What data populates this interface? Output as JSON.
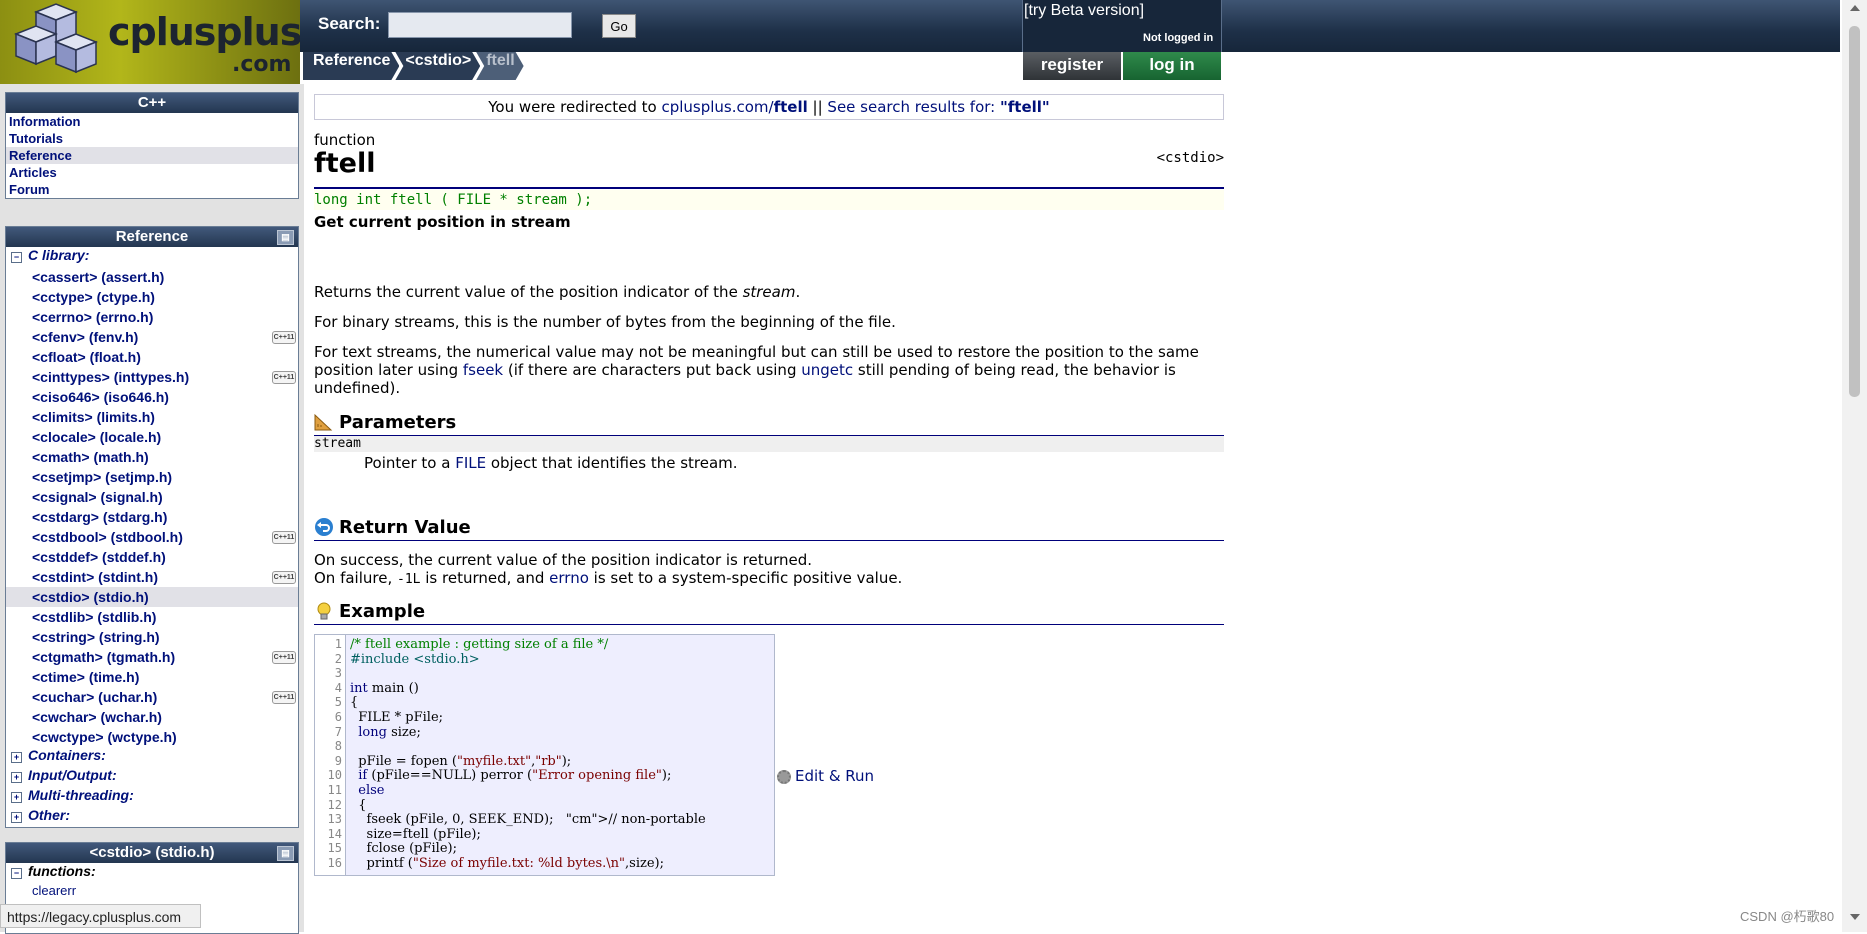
{
  "search": {
    "label": "Search:",
    "placeholder": "",
    "go_label": "Go"
  },
  "header": {
    "beta_link": "[try Beta version]",
    "login_status": "Not logged in"
  },
  "breadcrumb": [
    "Reference",
    "<cstdio>",
    "ftell"
  ],
  "auth": {
    "register": "register",
    "login": "log in"
  },
  "logo": {
    "word": "cplusplus",
    "domain": ".com"
  },
  "sidebar": {
    "cpp_box": {
      "title": "C++",
      "items": [
        "Information",
        "Tutorials",
        "Reference",
        "Articles",
        "Forum"
      ],
      "selected": "Reference"
    },
    "reference_box": {
      "title": "Reference",
      "c_library_label": "C library:",
      "c_library_items": [
        {
          "label": "<cassert> (assert.h)",
          "badge": ""
        },
        {
          "label": "<cctype> (ctype.h)",
          "badge": ""
        },
        {
          "label": "<cerrno> (errno.h)",
          "badge": ""
        },
        {
          "label": "<cfenv> (fenv.h)",
          "badge": "C++11"
        },
        {
          "label": "<cfloat> (float.h)",
          "badge": ""
        },
        {
          "label": "<cinttypes> (inttypes.h)",
          "badge": "C++11"
        },
        {
          "label": "<ciso646> (iso646.h)",
          "badge": ""
        },
        {
          "label": "<climits> (limits.h)",
          "badge": ""
        },
        {
          "label": "<clocale> (locale.h)",
          "badge": ""
        },
        {
          "label": "<cmath> (math.h)",
          "badge": ""
        },
        {
          "label": "<csetjmp> (setjmp.h)",
          "badge": ""
        },
        {
          "label": "<csignal> (signal.h)",
          "badge": ""
        },
        {
          "label": "<cstdarg> (stdarg.h)",
          "badge": ""
        },
        {
          "label": "<cstdbool> (stdbool.h)",
          "badge": "C++11"
        },
        {
          "label": "<cstddef> (stddef.h)",
          "badge": ""
        },
        {
          "label": "<cstdint> (stdint.h)",
          "badge": "C++11"
        },
        {
          "label": "<cstdio> (stdio.h)",
          "badge": ""
        },
        {
          "label": "<cstdlib> (stdlib.h)",
          "badge": ""
        },
        {
          "label": "<cstring> (string.h)",
          "badge": ""
        },
        {
          "label": "<ctgmath> (tgmath.h)",
          "badge": "C++11"
        },
        {
          "label": "<ctime> (time.h)",
          "badge": ""
        },
        {
          "label": "<cuchar> (uchar.h)",
          "badge": "C++11"
        },
        {
          "label": "<cwchar> (wchar.h)",
          "badge": ""
        },
        {
          "label": "<cwctype> (wctype.h)",
          "badge": ""
        }
      ],
      "selected": "<cstdio> (stdio.h)",
      "other_categories": [
        "Containers:",
        "Input/Output:",
        "Multi-threading:",
        "Other:"
      ]
    },
    "cstdio_box": {
      "title": "<cstdio> (stdio.h)",
      "functions_label": "functions:",
      "first_item": "clearerr"
    }
  },
  "statusbar": {
    "url": "https://legacy.cplusplus.com"
  },
  "main": {
    "redirect": {
      "prefix": "You were redirected to ",
      "link_domain": "cplusplus.com/",
      "link_page": "ftell",
      "sep": " || ",
      "search_text": "See search results for: ",
      "search_term": "\"ftell\""
    },
    "kind": "function",
    "name": "ftell",
    "header_ref": "<cstdio>",
    "prototype": "long int ftell ( FILE * stream );",
    "description_title": "Get current position in stream",
    "desc_p1_a": "Returns the current value of the position indicator of the ",
    "desc_p1_em": "stream",
    "desc_p1_b": ".",
    "desc_p2": "For binary streams, this is the number of bytes from the beginning of the file.",
    "desc_p3_a": "For text streams, the numerical value may not be meaningful but can still be used to restore the position to the same position later using ",
    "desc_p3_link1": "fseek",
    "desc_p3_b": " (if there are characters put back using ",
    "desc_p3_link2": "ungetc",
    "desc_p3_c": " still pending of being read, the behavior is undefined).",
    "parameters_title": "Parameters",
    "param_name": "stream",
    "param_desc_a": "Pointer to a ",
    "param_desc_link": "FILE",
    "param_desc_b": " object that identifies the stream.",
    "return_title": "Return Value",
    "return_1": "On success, the current value of the position indicator is returned.",
    "return_2_a": "On failure, ",
    "return_2_code": "-1L",
    "return_2_b": " is returned, and ",
    "return_2_link": "errno",
    "return_2_c": " is set to a system-specific positive value.",
    "example_title": "Example",
    "edit_run": "Edit & Run",
    "code_lines": [
      "/* ftell example : getting size of a file */",
      "#include <stdio.h>",
      "",
      "int main ()",
      "{",
      "  FILE * pFile;",
      "  long size;",
      "",
      "  pFile = fopen (\"myfile.txt\",\"rb\");",
      "  if (pFile==NULL) perror (\"Error opening file\");",
      "  else",
      "  {",
      "    fseek (pFile, 0, SEEK_END);   // non-portable",
      "    size=ftell (pFile);",
      "    fclose (pFile);",
      "    printf (\"Size of myfile.txt: %ld bytes.\\n\",size);"
    ]
  },
  "watermark": "CSDN @朽歌80",
  "colors": {
    "header_bg": "#1e3048",
    "link": "#00107a",
    "login_green": "#176431",
    "code_bg": "#eeeefe",
    "prototype_green": "#008000"
  }
}
